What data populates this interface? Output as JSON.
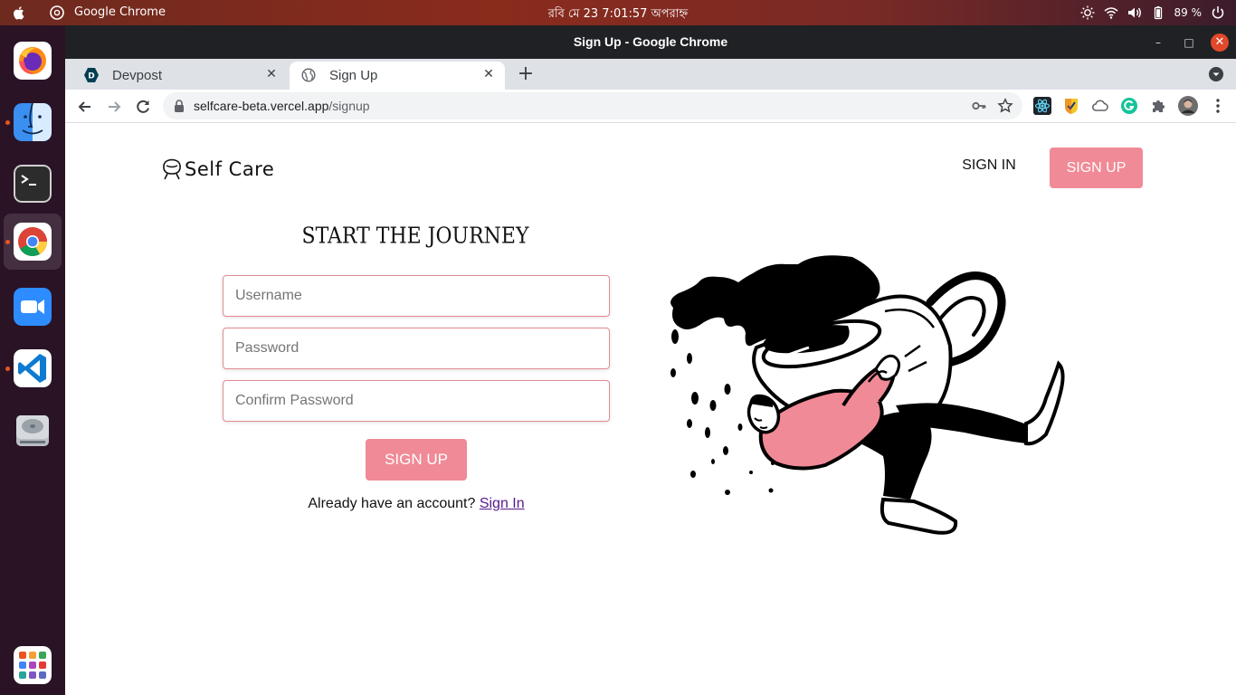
{
  "system": {
    "app_name": "Google Chrome",
    "clock": "রবি মে 23   7:01:57 অপরাহ্ন",
    "battery": "89 %"
  },
  "dock": {
    "items": [
      "firefox",
      "finder",
      "terminal",
      "chrome",
      "zoom",
      "vscode",
      "disk",
      "app-grid"
    ]
  },
  "window": {
    "title": "Sign Up - Google Chrome"
  },
  "tabs": [
    {
      "label": "Devpost"
    },
    {
      "label": "Sign Up"
    }
  ],
  "address_bar": {
    "host": "selfcare-beta.vercel.app",
    "path": "/signup"
  },
  "page": {
    "brand": "Self Care",
    "nav": {
      "sign_in": "SIGN IN",
      "sign_up": "SIGN UP"
    },
    "heading": "START THE JOURNEY",
    "form": {
      "username_placeholder": "Username",
      "password_placeholder": "Password",
      "confirm_placeholder": "Confirm Password",
      "submit": "SIGN UP",
      "already_text": "Already have an account?",
      "signin_link": "Sign In"
    }
  },
  "colors": {
    "accent": "#f08a96",
    "link": "#551a8b",
    "topbar": "#8a2b1c",
    "dock": "#2b1326"
  }
}
